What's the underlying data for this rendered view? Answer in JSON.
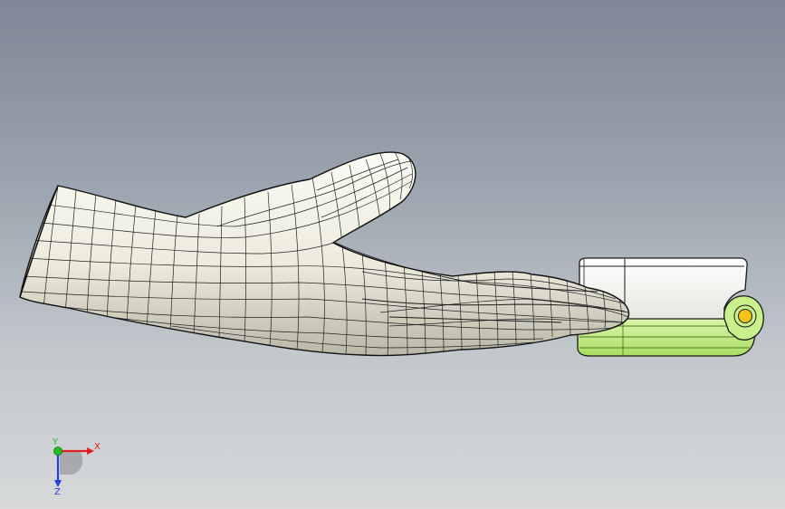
{
  "viewport": {
    "background_top": "#7e8896",
    "background_bottom": "#d7d9da"
  },
  "model": {
    "hand_color": "#f2f2e6",
    "device_body_color": "#ffffff",
    "device_base_color": "#c9f08a",
    "pin_color": "#f4c21a",
    "edge_color": "#1a1a1a"
  },
  "triad": {
    "x_label": "X",
    "y_label": "Y",
    "z_label": "Z",
    "x_color": "#e02020",
    "y_color": "#20c020",
    "z_color": "#2040e0"
  }
}
